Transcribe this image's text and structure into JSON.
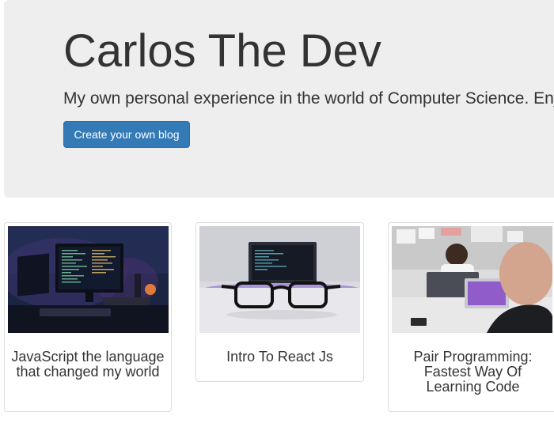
{
  "hero": {
    "title": "Carlos The Dev",
    "tagline": "My own personal experience in the world of Computer Science. Enjoy!",
    "cta_label": "Create your own blog"
  },
  "posts": [
    {
      "title": "JavaScript the language that changed my world",
      "image": "desk-setup-monitors-photo"
    },
    {
      "title": "Intro To React Js",
      "image": "laptop-glasses-photo"
    },
    {
      "title": "Pair Programming: Fastest Way Of Learning Code",
      "image": "pair-programming-photo"
    }
  ],
  "colors": {
    "jumbotron_bg": "#eeeeee",
    "primary_button": "#337ab7",
    "text": "#333333"
  }
}
